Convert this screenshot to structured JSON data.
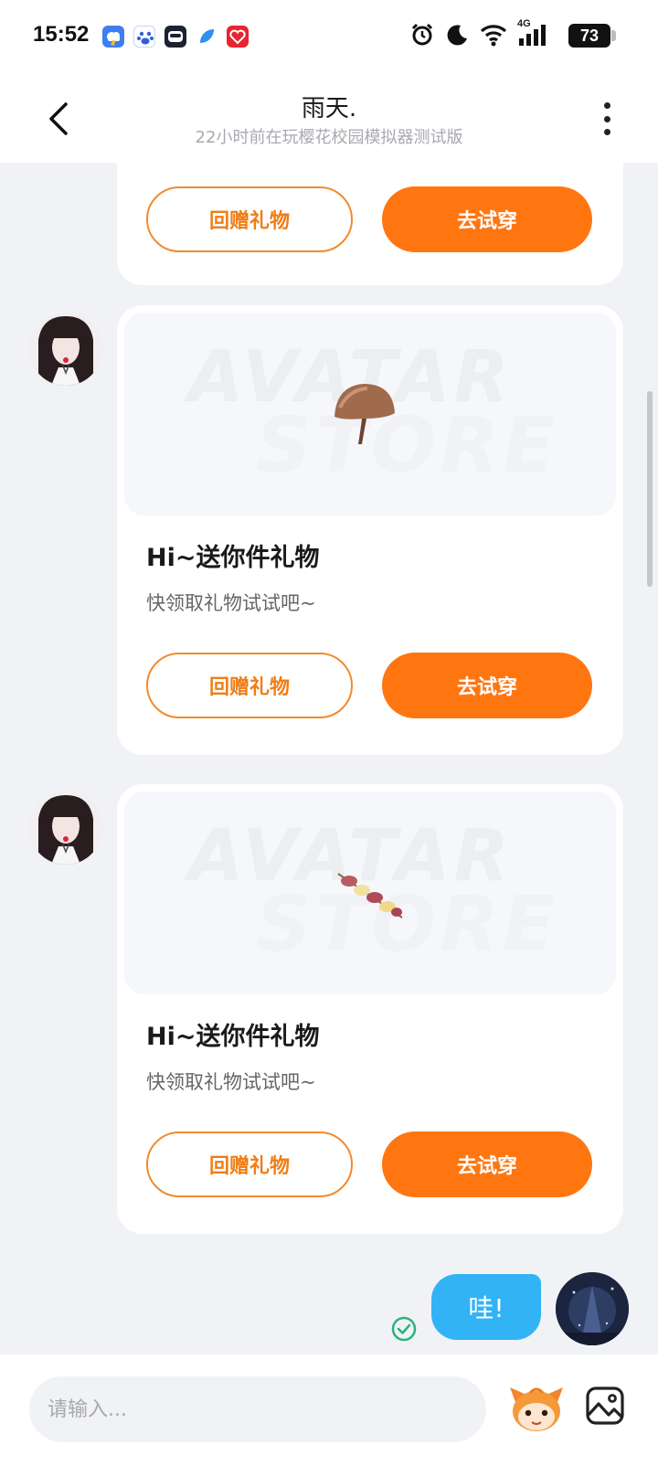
{
  "status_bar": {
    "time": "15:52",
    "network": "4G",
    "battery": "73",
    "icons": [
      "cloud-weather-icon",
      "baidu-paw-icon",
      "app-face-icon",
      "feather-app-icon",
      "red-heart-app-icon",
      "alarm-icon",
      "moon-icon",
      "wifi-icon",
      "signal-icon"
    ]
  },
  "header": {
    "title": "雨天.",
    "subtitle": "22小时前在玩樱花校园模拟器测试版"
  },
  "cards": [
    {
      "return_gift_label": "回赠礼物",
      "try_on_label": "去试穿"
    },
    {
      "watermark_top": "AVATAR",
      "watermark_bottom": "STORE",
      "item": "mushroom",
      "title": "Hi~送你件礼物",
      "desc": "快领取礼物试试吧~",
      "return_gift_label": "回赠礼物",
      "try_on_label": "去试穿"
    },
    {
      "watermark_top": "AVATAR",
      "watermark_bottom": "STORE",
      "item": "kebab-skewer",
      "title": "Hi~送你件礼物",
      "desc": "快领取礼物试试吧~",
      "return_gift_label": "回赠礼物",
      "try_on_label": "去试穿"
    }
  ],
  "my_message": {
    "text": "哇!",
    "status": "sent"
  },
  "input": {
    "placeholder": "请输入..."
  },
  "colors": {
    "accent": "#ff7611",
    "bubble": "#31b3f5",
    "check": "#2bb37a"
  }
}
